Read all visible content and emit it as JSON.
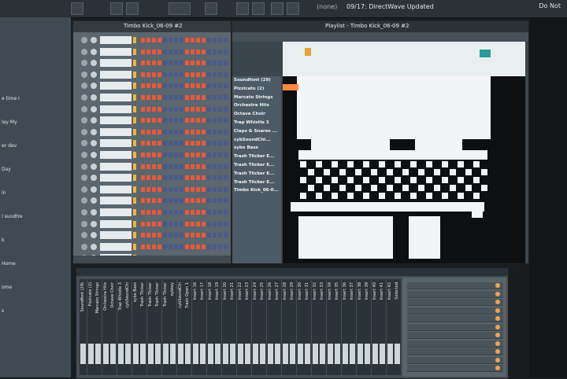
{
  "toolbar": {
    "pattern_label": "(none)",
    "hint": "09/17: DirectWave Updated",
    "logo_text": "Do Not"
  },
  "browser": {
    "items": [
      "e time I",
      "lay My",
      "er dev",
      "Day",
      "in",
      "I sundtre",
      "k",
      "Home",
      "ome",
      "s"
    ]
  },
  "channel_rack": {
    "title": "Timbo Kick_06-09 #2",
    "channels": 20
  },
  "playlist": {
    "title": "Playlist - Timbo Kick_06-09 #2",
    "tracks": [
      "Soundfont (29)",
      "Pizzicato (2)",
      "Marcato Strings",
      "Orchestra Hits",
      "Octave Choir",
      "Trap Whistle 3",
      "Claps & Snares ...",
      "cybSoundChi...",
      "sybo Bass",
      "Trash Tlicker E...",
      "Trash Tlicker E...",
      "Trash Tlicker E...",
      "Trash Tlicker E...",
      "Timbo Kick_06-0..."
    ]
  },
  "mixer": {
    "strips": [
      "Soundfont (29)",
      "Pizzicato (2)",
      "Marcato Strings",
      "Orchestra Hits",
      "Octave Choir",
      "Trap Whistle 3",
      "cybSoundChi",
      "sybo Bass",
      "Trash Tlicker",
      "Trash Tlicker",
      "Trash Tlicker",
      "Trash Tlicker",
      "sybkey",
      "cybSoundChi",
      "Trash Open 1",
      "Insert 16",
      "Insert 17",
      "Insert 18",
      "Insert 19",
      "Insert 20",
      "Insert 21",
      "Insert 22",
      "Insert 23",
      "Insert 24",
      "Insert 25",
      "Insert 26",
      "Insert 27",
      "Insert 28",
      "Insert 29",
      "Insert 30",
      "Insert 31",
      "Insert 32",
      "Insert 33",
      "Insert 34",
      "Insert 35",
      "Insert 36",
      "Insert 37",
      "Insert 38",
      "Insert 39",
      "Insert 40",
      "Insert 41",
      "Insert 42",
      "Selected"
    ]
  }
}
